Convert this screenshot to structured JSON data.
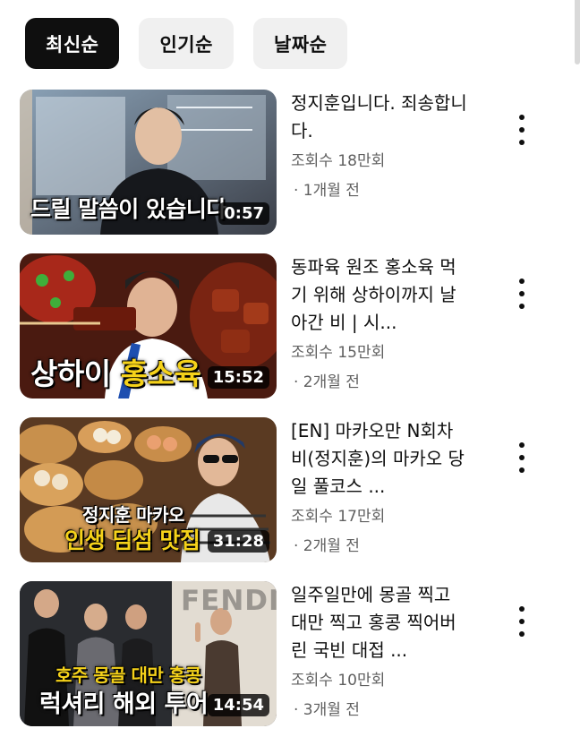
{
  "chips": [
    {
      "label": "최신순",
      "active": true
    },
    {
      "label": "인기순",
      "active": false
    },
    {
      "label": "날짜순",
      "active": false
    }
  ],
  "videos": [
    {
      "title": "정지훈입니다. 죄송합니다.",
      "views": "조회수 18만회",
      "date": "· 1개월 전",
      "duration": "0:57",
      "overlay": [
        "드릴 말씀이 있습니다"
      ],
      "overlay_color": "#ffffff"
    },
    {
      "title": "동파육 원조 홍소육 먹기 위해 상하이까지 날아간 비 | 시...",
      "views": "조회수 15만회",
      "date": "· 2개월 전",
      "duration": "15:52",
      "overlay": [
        "상하이",
        "홍소육"
      ],
      "overlay_color": "#f5d21a"
    },
    {
      "title": "[EN] 마카오만 N회차 비(정지훈)의 마카오 당일 풀코스 ...",
      "views": "조회수 17만회",
      "date": "· 2개월 전",
      "duration": "31:28",
      "overlay": [
        "정지훈 마카오",
        "인생 딤섬 맛집"
      ],
      "overlay_color": "#f5d21a"
    },
    {
      "title": "일주일만에 몽골 찍고 대만 찍고 홍콩 찍어버린 국빈 대접 ...",
      "views": "조회수 10만회",
      "date": "· 3개월 전",
      "duration": "14:54",
      "overlay": [
        "호주 몽골 대만 홍콩",
        "럭셔리 해외 투어"
      ],
      "overlay_color": "#f5d21a",
      "brand_text": "FENDI"
    }
  ],
  "icons": {
    "more": "more-vert-icon"
  }
}
